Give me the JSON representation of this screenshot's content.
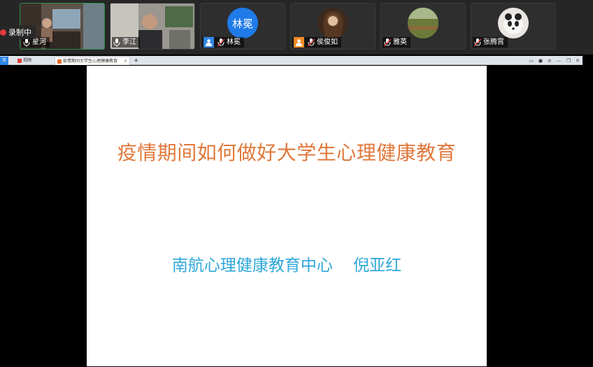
{
  "recording": {
    "label": "录制中"
  },
  "participants": [
    {
      "name": "星河",
      "type": "video",
      "active": true
    },
    {
      "name": "李江",
      "type": "video",
      "active": false
    },
    {
      "name": "林冕",
      "type": "avatar-text",
      "avatar_text": "林冕",
      "muted": true
    },
    {
      "name": "侯俊如",
      "type": "avatar-photo",
      "muted": true
    },
    {
      "name": "雅英",
      "type": "avatar-photo",
      "muted": true
    },
    {
      "name": "张腾霄",
      "type": "avatar-photo",
      "muted": true
    }
  ],
  "browser": {
    "tabs": [
      {
        "label": "页"
      },
      {
        "label": "视频"
      },
      {
        "label": "疫情期间大学生心理健康教育"
      }
    ],
    "new_tab": "+"
  },
  "slide": {
    "title": "疫情期间如何做好大学生心理健康教育",
    "subtitle": "南航心理健康教育中心    倪亚红"
  },
  "colors": {
    "title": "#e0783b",
    "subtitle": "#2ea7d9",
    "avatar_blue": "#1f7be8",
    "user_badge_blue": "#2f86e5",
    "user_badge_orange": "#f08a24"
  }
}
